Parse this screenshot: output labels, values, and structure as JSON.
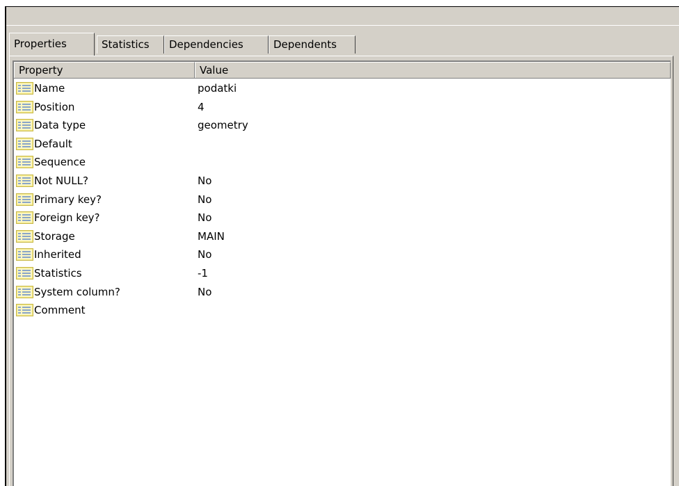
{
  "tabs": [
    {
      "label": "Properties",
      "active": true
    },
    {
      "label": "Statistics",
      "active": false
    },
    {
      "label": "Dependencies",
      "active": false
    },
    {
      "label": "Dependents",
      "active": false
    }
  ],
  "columns": {
    "property": "Property",
    "value": "Value"
  },
  "row_icon": "property-list-icon",
  "colors": {
    "icon_fill": "#f3e98a",
    "icon_lines": "#8aa6c8",
    "panel_bg": "#d4d0c8"
  },
  "rows": [
    {
      "property": "Name",
      "value": "podatki"
    },
    {
      "property": "Position",
      "value": "4"
    },
    {
      "property": "Data type",
      "value": "geometry"
    },
    {
      "property": "Default",
      "value": ""
    },
    {
      "property": "Sequence",
      "value": ""
    },
    {
      "property": "Not NULL?",
      "value": "No"
    },
    {
      "property": "Primary key?",
      "value": "No"
    },
    {
      "property": "Foreign key?",
      "value": "No"
    },
    {
      "property": "Storage",
      "value": "MAIN"
    },
    {
      "property": "Inherited",
      "value": "No"
    },
    {
      "property": "Statistics",
      "value": "-1"
    },
    {
      "property": "System column?",
      "value": "No"
    },
    {
      "property": "Comment",
      "value": ""
    }
  ]
}
